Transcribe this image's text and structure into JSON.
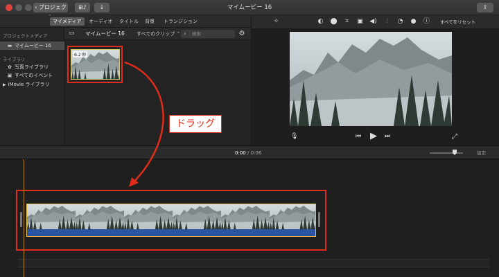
{
  "window": {
    "title": "マイムービー 16",
    "back_label": "‹ プロジェクト",
    "media_btn": "⊞♪",
    "import_btn": "↓",
    "share_btn": "⇪"
  },
  "tabs": [
    {
      "label": "マイメディア",
      "active": true
    },
    {
      "label": "オーディオ"
    },
    {
      "label": "タイトル"
    },
    {
      "label": "背景"
    },
    {
      "label": "トランジション"
    }
  ],
  "sidebar": {
    "project_media_header": "プロジェクトメディア",
    "project_item": "マイムービー 16",
    "libraries_header": "ライブラリ",
    "photo_library": "写真ライブラリ",
    "all_events": "すべてのイベント",
    "imovie_library": "iMovie ライブラリ"
  },
  "browser": {
    "title": "マイムービー 16",
    "filter": "すべてのクリップ ⌃",
    "search_placeholder": "検索",
    "clip_duration": "6.2 秒"
  },
  "viewer": {
    "reset_label": "すべてをリセット"
  },
  "timeline": {
    "current_time": "0:00",
    "separator": "/",
    "total_time": "0:06",
    "settings_label": "設定",
    "zoom_level": 0.75
  },
  "annotation": {
    "drag_label": "ドラッグ"
  },
  "colors": {
    "accent_red": "#e02c1a",
    "clip_border": "#e7c03f",
    "audio_blue": "#2b55a2",
    "playhead": "#b8862e"
  },
  "icons": {
    "magic": "✧",
    "color_balance": "◐",
    "color_correction": "⬤",
    "crop": "⌗",
    "stabilize": "▣",
    "volume": "◀)",
    "noise": "⫶",
    "speed": "◔",
    "filter": "●",
    "info": "ⓘ",
    "mic": "🎙",
    "prev": "⏮",
    "play": "▶",
    "next": "⏭",
    "fullscreen": "⤢"
  }
}
